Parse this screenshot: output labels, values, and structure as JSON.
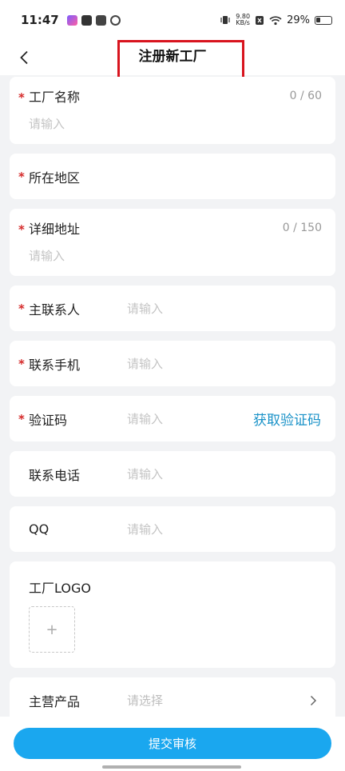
{
  "status_bar": {
    "time": "11:47",
    "net_speed_value": "9.80",
    "net_speed_unit": "KB/s",
    "battery": "29%"
  },
  "nav": {
    "title": "注册新工厂"
  },
  "form": {
    "factory_name": {
      "label": "工厂名称",
      "counter": "0 / 60",
      "placeholder": "请输入"
    },
    "region": {
      "label": "所在地区"
    },
    "address": {
      "label": "详细地址",
      "counter": "0 / 150",
      "placeholder": "请输入"
    },
    "contact_person": {
      "label": "主联系人",
      "placeholder": "请输入"
    },
    "contact_mobile": {
      "label": "联系手机",
      "placeholder": "请输入"
    },
    "verify_code": {
      "label": "验证码",
      "placeholder": "请输入",
      "action": "获取验证码"
    },
    "contact_phone": {
      "label": "联系电话",
      "placeholder": "请输入"
    },
    "qq": {
      "label": "QQ",
      "placeholder": "请输入"
    },
    "logo": {
      "label": "工厂LOGO",
      "upload": "+"
    },
    "main_products": {
      "label": "主营产品",
      "placeholder": "请选择"
    },
    "required_mark": "*"
  },
  "footer": {
    "submit_label": "提交审核"
  },
  "colors": {
    "accent": "#1aa7ef",
    "link": "#1a92c8",
    "required": "#d52a2a",
    "highlight": "#d8141e"
  }
}
